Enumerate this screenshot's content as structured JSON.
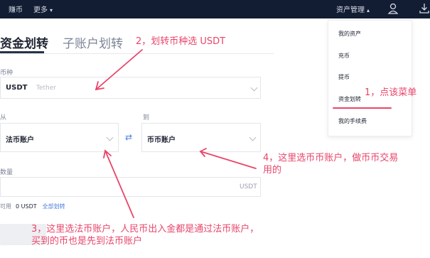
{
  "topbar": {
    "nav_earn": "赚币",
    "nav_more": "更多",
    "nav_assets": "资产管理"
  },
  "tabs": {
    "active": "资金划转",
    "inactive": "子账户划转"
  },
  "form": {
    "currency_label": "币种",
    "currency_value": "USDT",
    "currency_name": "Tether",
    "from_label": "从",
    "from_value": "法币账户",
    "to_label": "到",
    "to_value": "币币账户",
    "amount_label": "数量",
    "amount_unit": "USDT",
    "available_label": "可用",
    "available_value": "0 USDT",
    "transfer_all": "全部划转"
  },
  "dropdown": {
    "items": [
      "我的资产",
      "充币",
      "提币",
      "资金划转",
      "我的手续费"
    ]
  },
  "annotations": {
    "note1": "1，点该菜单",
    "note2": "2，划转币种选 USDT",
    "note3_line1": "3，这里选法币账户，人民币出入金都是通过法币账户，",
    "note3_line2": "买到的币也是先到法币账户",
    "note4_line1": "4，这里选币币账户，做币币交易",
    "note4_line2": "用的"
  },
  "colors": {
    "annotation": "#e8456a",
    "topbar": "#121d33",
    "link": "#4c7de0"
  }
}
